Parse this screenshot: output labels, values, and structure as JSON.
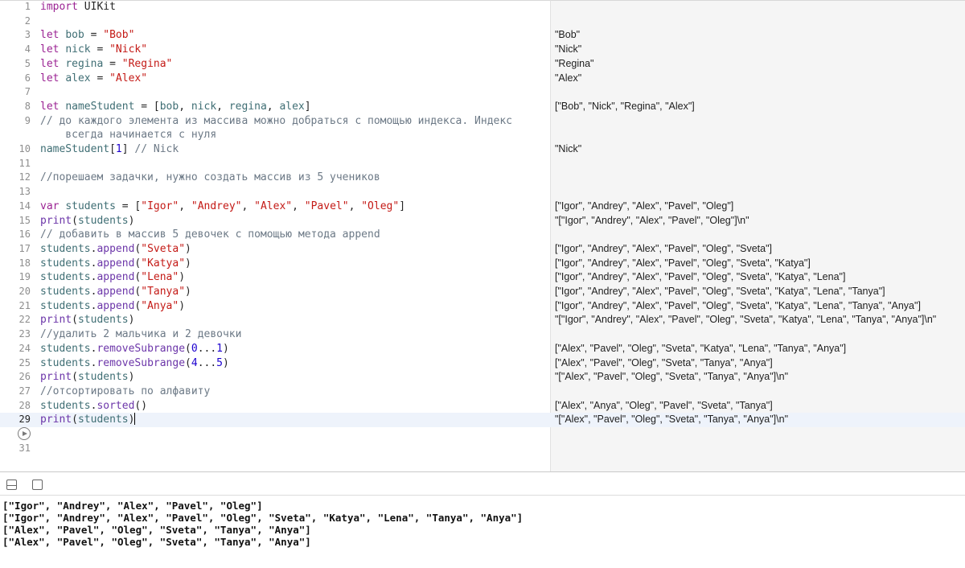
{
  "editor": {
    "line_numbers": [
      "1",
      "2",
      "3",
      "4",
      "5",
      "6",
      "7",
      "8",
      "9",
      "10",
      "11",
      "12",
      "13",
      "14",
      "15",
      "16",
      "17",
      "18",
      "19",
      "20",
      "21",
      "22",
      "23",
      "24",
      "25",
      "26",
      "27",
      "28",
      "29",
      "31"
    ],
    "code": {
      "l1": [
        "import",
        " UIKit"
      ],
      "l3": [
        "let",
        " ",
        "bob",
        " = ",
        "\"Bob\""
      ],
      "l4": [
        "let",
        " ",
        "nick",
        " = ",
        "\"Nick\""
      ],
      "l5": [
        "let",
        " ",
        "regina",
        " = ",
        "\"Regina\""
      ],
      "l6": [
        "let",
        " ",
        "alex",
        " = ",
        "\"Alex\""
      ],
      "l8": [
        "let",
        " ",
        "nameStudent",
        " = [",
        "bob",
        ", ",
        "nick",
        ", ",
        "regina",
        ", ",
        "alex",
        "]"
      ],
      "l9": "// до каждого элемента из массива можно добраться с помощью индекса. Индекс\n    всегда начинается с нуля",
      "l10": [
        "nameStudent",
        "[",
        "1",
        "] ",
        "// Nick"
      ],
      "l12": "//порешаем задачки, нужно создать массив из 5 учеников",
      "l14": [
        "var",
        " ",
        "students",
        " = [",
        "\"Igor\"",
        ", ",
        "\"Andrey\"",
        ", ",
        "\"Alex\"",
        ", ",
        "\"Pavel\"",
        ", ",
        "\"Oleg\"",
        "]"
      ],
      "l15": [
        "print",
        "(",
        "students",
        ")"
      ],
      "l16": "// добавить в массив 5 девочек с помощью метода append",
      "l17": [
        "students",
        ".",
        "append",
        "(",
        "\"Sveta\"",
        ")"
      ],
      "l18": [
        "students",
        ".",
        "append",
        "(",
        "\"Katya\"",
        ")"
      ],
      "l19": [
        "students",
        ".",
        "append",
        "(",
        "\"Lena\"",
        ")"
      ],
      "l20": [
        "students",
        ".",
        "append",
        "(",
        "\"Tanya\"",
        ")"
      ],
      "l21": [
        "students",
        ".",
        "append",
        "(",
        "\"Anya\"",
        ")"
      ],
      "l22": [
        "print",
        "(",
        "students",
        ")"
      ],
      "l23": "//удалить 2 мальчика и 2 девочки",
      "l24": [
        "students",
        ".",
        "removeSubrange",
        "(",
        "0",
        "...",
        "1",
        ")"
      ],
      "l25": [
        "students",
        ".",
        "removeSubrange",
        "(",
        "4",
        "...",
        "5",
        ")"
      ],
      "l26": [
        "print",
        "(",
        "students",
        ")"
      ],
      "l27": "//отсортировать по алфавиту",
      "l28": [
        "students",
        ".",
        "sorted",
        "()"
      ],
      "l29": [
        "print",
        "(",
        "students",
        ")"
      ]
    }
  },
  "results": {
    "r3": "\"Bob\"",
    "r4": "\"Nick\"",
    "r5": "\"Regina\"",
    "r6": "\"Alex\"",
    "r8": "[\"Bob\", \"Nick\", \"Regina\", \"Alex\"]",
    "r10": "\"Nick\"",
    "r14": "[\"Igor\", \"Andrey\", \"Alex\", \"Pavel\", \"Oleg\"]",
    "r15": "\"[\"Igor\", \"Andrey\", \"Alex\", \"Pavel\", \"Oleg\"]\\n\"",
    "r17": "[\"Igor\", \"Andrey\", \"Alex\", \"Pavel\", \"Oleg\", \"Sveta\"]",
    "r18": "[\"Igor\", \"Andrey\", \"Alex\", \"Pavel\", \"Oleg\", \"Sveta\", \"Katya\"]",
    "r19": "[\"Igor\", \"Andrey\", \"Alex\", \"Pavel\", \"Oleg\", \"Sveta\", \"Katya\", \"Lena\"]",
    "r20": "[\"Igor\", \"Andrey\", \"Alex\", \"Pavel\", \"Oleg\", \"Sveta\", \"Katya\", \"Lena\", \"Tanya\"]",
    "r21": "[\"Igor\", \"Andrey\", \"Alex\", \"Pavel\", \"Oleg\", \"Sveta\", \"Katya\", \"Lena\", \"Tanya\", \"Anya\"]",
    "r22": "\"[\"Igor\", \"Andrey\", \"Alex\", \"Pavel\", \"Oleg\", \"Sveta\", \"Katya\", \"Lena\", \"Tanya\", \"Anya\"]\\n\"",
    "r24": "[\"Alex\", \"Pavel\", \"Oleg\", \"Sveta\", \"Katya\", \"Lena\", \"Tanya\", \"Anya\"]",
    "r25": "[\"Alex\", \"Pavel\", \"Oleg\", \"Sveta\", \"Tanya\", \"Anya\"]",
    "r26": "\"[\"Alex\", \"Pavel\", \"Oleg\", \"Sveta\", \"Tanya\", \"Anya\"]\\n\"",
    "r28": "[\"Alex\", \"Anya\", \"Oleg\", \"Pavel\", \"Sveta\", \"Tanya\"]",
    "r29": "\"[\"Alex\", \"Pavel\", \"Oleg\", \"Sveta\", \"Tanya\", \"Anya\"]\\n\""
  },
  "toolbar": {
    "hide_debug_icon": "hide-debug-area-icon",
    "run_icon": "play-icon"
  },
  "console": {
    "lines": [
      "[\"Igor\", \"Andrey\", \"Alex\", \"Pavel\", \"Oleg\"]",
      "[\"Igor\", \"Andrey\", \"Alex\", \"Pavel\", \"Oleg\", \"Sveta\", \"Katya\", \"Lena\", \"Tanya\", \"Anya\"]",
      "[\"Alex\", \"Pavel\", \"Oleg\", \"Sveta\", \"Tanya\", \"Anya\"]",
      "[\"Alex\", \"Pavel\", \"Oleg\", \"Sveta\", \"Tanya\", \"Anya\"]"
    ]
  },
  "colors": {
    "keyword": "#9b2393",
    "identifier": "#3f6e74",
    "string": "#c41a16",
    "function": "#6c36a9",
    "comment": "#6c7986",
    "number": "#1c00cf",
    "active_line": "#eef3fb"
  }
}
